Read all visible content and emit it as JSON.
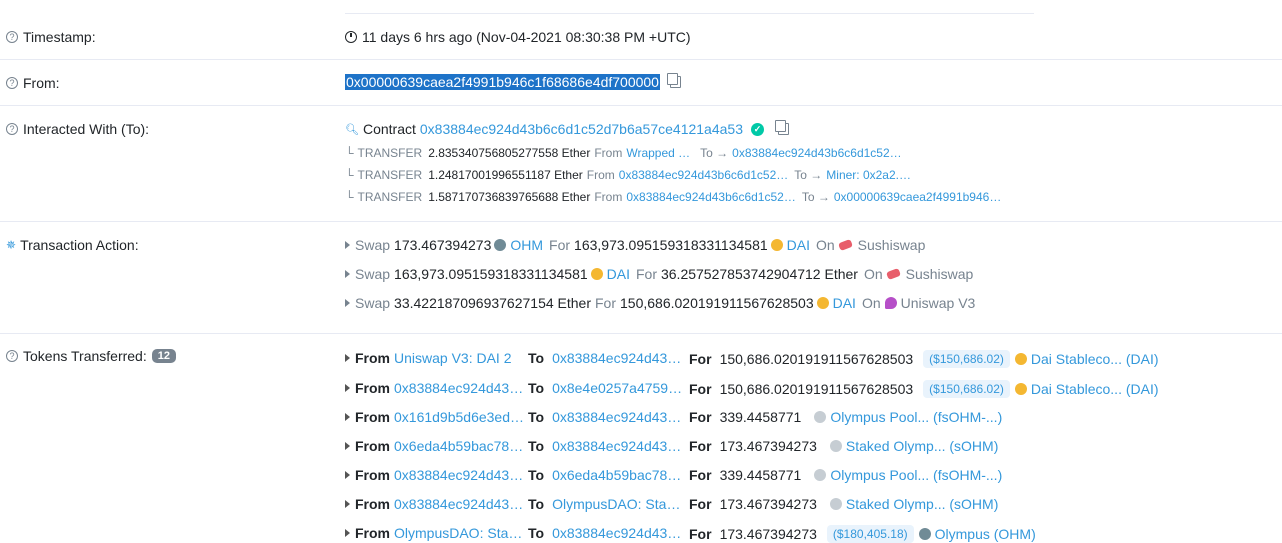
{
  "timestamp": {
    "label": "Timestamp:",
    "value": "11 days 6 hrs ago (Nov-04-2021 08:30:38 PM +UTC)"
  },
  "from": {
    "label": "From:",
    "address": "0x00000639caea2f4991b946c1f68686e4df700000"
  },
  "interacted": {
    "label": "Interacted With (To):",
    "contract_prefix": "Contract",
    "contract_address": "0x83884ec924d43b6c6d1c52d7b6a57ce4121a4a53",
    "transfers": [
      {
        "type": "TRANSFER",
        "amount": "2.835340756805277558 Ether",
        "from_label": "From",
        "from": "Wrapped …",
        "to_label": "To →",
        "to": "0x83884ec924d43b6c6d1c52…"
      },
      {
        "type": "TRANSFER",
        "amount": "1.24817001996551187 Ether",
        "from_label": "From",
        "from": "0x83884ec924d43b6c6d1c52…",
        "to_label": "To →",
        "to": "Miner: 0x2a2.…"
      },
      {
        "type": "TRANSFER",
        "amount": "1.587170736839765688 Ether",
        "from_label": "From",
        "from": "0x83884ec924d43b6c6d1c52…",
        "to_label": "To →",
        "to": "0x00000639caea2f4991b946…"
      }
    ]
  },
  "action": {
    "label": "Transaction Action:",
    "swaps": [
      {
        "verb": "Swap",
        "amount1": "173.467394273",
        "token1": "OHM",
        "for": "For",
        "amount2": "163,973.095159318331134581",
        "token2": "DAI",
        "on": "On",
        "dex": "Sushiswap"
      },
      {
        "verb": "Swap",
        "amount1": "163,973.095159318331134581",
        "token1": "DAI",
        "for": "For",
        "amount2": "36.257527853742904712 Ether",
        "token2": "",
        "on": "On",
        "dex": "Sushiswap"
      },
      {
        "verb": "Swap",
        "amount1": "33.422187096937627154 Ether",
        "token1": "",
        "for": "For",
        "amount2": "150,686.020191911567628503",
        "token2": "DAI",
        "on": "On",
        "dex": "Uniswap V3"
      }
    ]
  },
  "tokens": {
    "label": "Tokens Transferred:",
    "count": "12",
    "rows": [
      {
        "from": "Uniswap V3: DAI 2",
        "to": "0x83884ec924d43…",
        "amount": "150,686.020191911567628503",
        "usd": "($150,686.02)",
        "token": "Dai Stableco... (DAI)",
        "icon": "dai"
      },
      {
        "from": "0x83884ec924d43…",
        "to": "0x8e4e0257a4759…",
        "amount": "150,686.020191911567628503",
        "usd": "($150,686.02)",
        "token": "Dai Stableco... (DAI)",
        "icon": "dai"
      },
      {
        "from": "0x161d9b5d6e3ed…",
        "to": "0x83884ec924d43…",
        "amount": "339.4458771",
        "usd": "",
        "token": "Olympus Pool... (fsOHM-...)",
        "icon": "grey"
      },
      {
        "from": "0x6eda4b59bac78…",
        "to": "0x83884ec924d43…",
        "amount": "173.467394273",
        "usd": "",
        "token": "Staked Olymp... (sOHM)",
        "icon": "grey"
      },
      {
        "from": "0x83884ec924d43…",
        "to": "0x6eda4b59bac78…",
        "amount": "339.4458771",
        "usd": "",
        "token": "Olympus Pool... (fsOHM-...)",
        "icon": "grey"
      },
      {
        "from": "0x83884ec924d43…",
        "to": "OlympusDAO: Sta…",
        "amount": "173.467394273",
        "usd": "",
        "token": "Staked Olymp... (sOHM)",
        "icon": "grey"
      },
      {
        "from": "OlympusDAO: Sta…",
        "to": "0x83884ec924d43…",
        "amount": "173.467394273",
        "usd": "($180,405.18)",
        "token": "Olympus (OHM)",
        "icon": "ohm"
      }
    ],
    "from_label": "From",
    "to_label": "To",
    "for_label": "For"
  }
}
